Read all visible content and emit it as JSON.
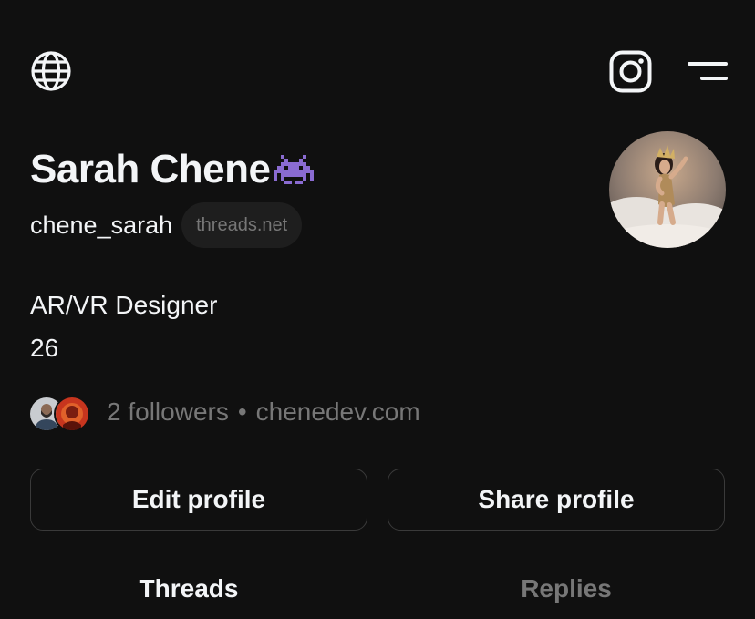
{
  "header": {
    "left_icon": "globe-icon",
    "right_icons": [
      "instagram-icon",
      "menu-icon"
    ]
  },
  "profile": {
    "name": "Sarah Chene",
    "name_emoji": "alien-monster-emoji",
    "handle": "chene_sarah",
    "domain_badge": "threads.net",
    "bio_lines": [
      "AR/VR Designer",
      "26"
    ],
    "followers_label": "2 followers",
    "separator": "•",
    "website": "chenedev.com"
  },
  "actions": {
    "edit_label": "Edit profile",
    "share_label": "Share profile"
  },
  "tabs": [
    {
      "label": "Threads",
      "active": true
    },
    {
      "label": "Replies",
      "active": false
    }
  ],
  "colors": {
    "background": "#101010",
    "primary_text": "#f3f5f7",
    "secondary_text": "#777777",
    "pill_bg": "#1e1e1e",
    "button_border": "#3a3a3a",
    "emoji_purple": "#8a6bd1"
  }
}
